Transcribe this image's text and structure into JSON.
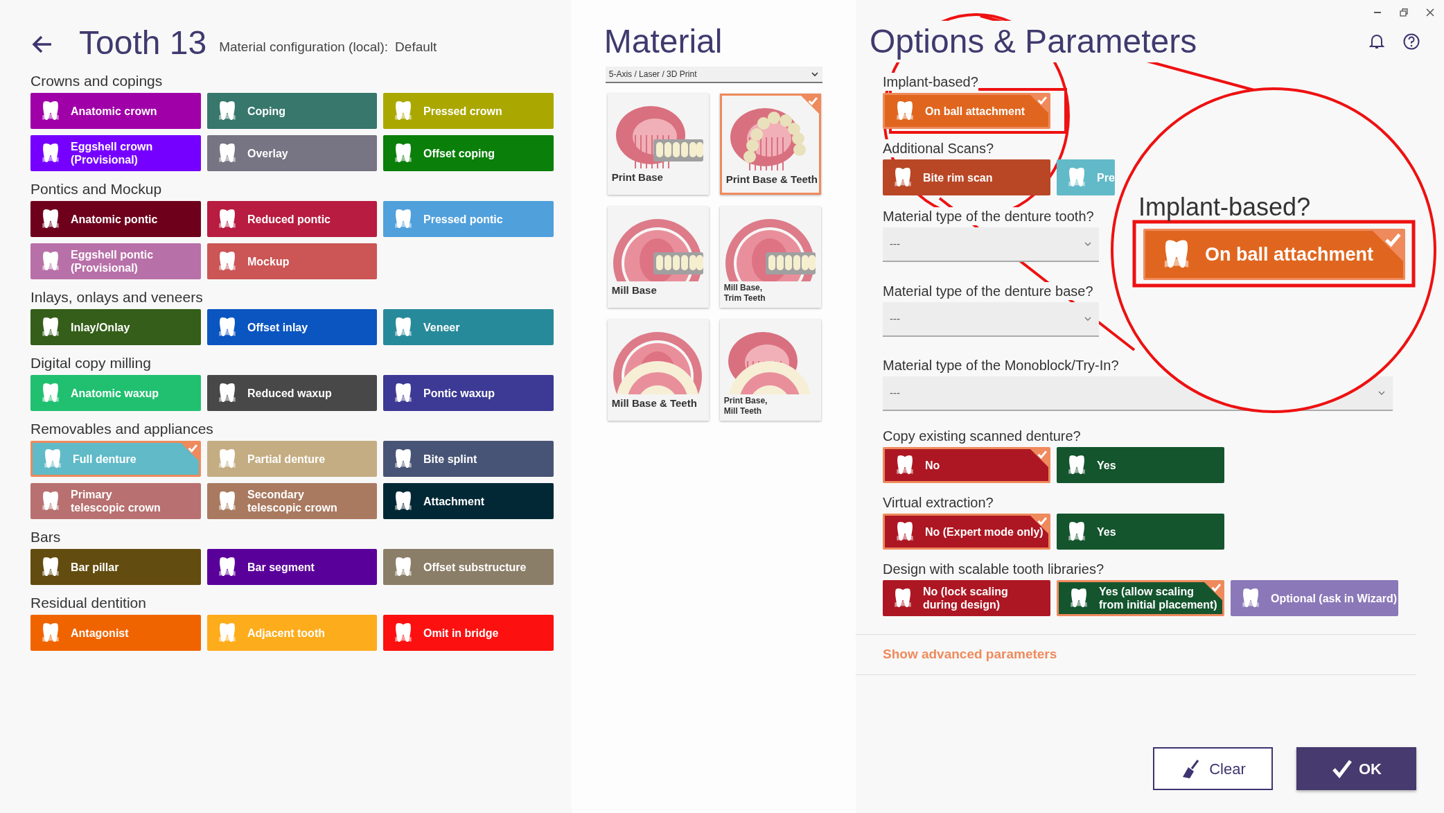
{
  "header": {
    "title": "Tooth 13",
    "config_label": "Material configuration (local):",
    "config_value": "Default"
  },
  "sections": [
    {
      "title": "Crowns and copings",
      "items": [
        {
          "label": "Anatomic crown",
          "color": "#a000a8",
          "selected": false
        },
        {
          "label": "Coping",
          "color": "#37776c",
          "selected": false
        },
        {
          "label": "Pressed crown",
          "color": "#aaa800",
          "selected": false
        },
        {
          "label": "Eggshell crown\n(Provisional)",
          "color": "#7600ff",
          "selected": false
        },
        {
          "label": "Overlay",
          "color": "#777584",
          "selected": false
        },
        {
          "label": "Offset coping",
          "color": "#0a7f0a",
          "selected": false
        }
      ]
    },
    {
      "title": "Pontics and Mockup",
      "items": [
        {
          "label": "Anatomic pontic",
          "color": "#6e001c",
          "selected": false
        },
        {
          "label": "Reduced pontic",
          "color": "#b81c40",
          "selected": false
        },
        {
          "label": "Pressed pontic",
          "color": "#50a0dc",
          "selected": false
        },
        {
          "label": "Eggshell pontic\n(Provisional)",
          "color": "#b870a8",
          "selected": false
        },
        {
          "label": "Mockup",
          "color": "#cc5555",
          "selected": false
        }
      ]
    },
    {
      "title": "Inlays, onlays and veneers",
      "items": [
        {
          "label": "Inlay/Onlay",
          "color": "#345e19",
          "selected": false
        },
        {
          "label": "Offset inlay",
          "color": "#0b55c0",
          "selected": false
        },
        {
          "label": "Veneer",
          "color": "#278a9a",
          "selected": false
        }
      ]
    },
    {
      "title": "Digital copy milling",
      "items": [
        {
          "label": "Anatomic waxup",
          "color": "#20c070",
          "selected": false
        },
        {
          "label": "Reduced waxup",
          "color": "#484848",
          "selected": false
        },
        {
          "label": "Pontic waxup",
          "color": "#3c3a94",
          "selected": false
        }
      ]
    },
    {
      "title": "Removables and appliances",
      "items": [
        {
          "label": "Full denture",
          "color": "#60bac8",
          "selected": true
        },
        {
          "label": "Partial denture",
          "color": "#c4ad82",
          "selected": false
        },
        {
          "label": "Bite splint",
          "color": "#485476",
          "selected": false
        },
        {
          "label": "Primary\ntelescopic crown",
          "color": "#b87070",
          "selected": false
        },
        {
          "label": "Secondary\ntelescopic crown",
          "color": "#a97a60",
          "selected": false
        },
        {
          "label": "Attachment",
          "color": "#022836",
          "selected": false
        }
      ]
    },
    {
      "title": "Bars",
      "items": [
        {
          "label": "Bar pillar",
          "color": "#634c0f",
          "selected": false
        },
        {
          "label": "Bar segment",
          "color": "#5a009a",
          "selected": false
        },
        {
          "label": "Offset substructure",
          "color": "#8b7e68",
          "selected": false
        }
      ]
    },
    {
      "title": "Residual dentition",
      "items": [
        {
          "label": "Antagonist",
          "color": "#f06400",
          "selected": false
        },
        {
          "label": "Adjacent tooth",
          "color": "#fdac1c",
          "selected": false
        },
        {
          "label": "Omit in bridge",
          "color": "#fc1010",
          "selected": false
        }
      ]
    }
  ],
  "material": {
    "title": "Material",
    "dropdown": "5-Axis / Laser / 3D Print",
    "cards": [
      {
        "label": "Print Base",
        "selected": false
      },
      {
        "label": "Print Base & Teeth",
        "selected": true
      },
      {
        "label": "Mill Base",
        "selected": false
      },
      {
        "label": "Mill Base,\nTrim Teeth",
        "selected": false
      },
      {
        "label": "Mill Base & Teeth",
        "selected": false
      },
      {
        "label": "Print Base,\nMill Teeth",
        "selected": false
      }
    ]
  },
  "options": {
    "title": "Options & Parameters",
    "questions": [
      {
        "kind": "buttons",
        "label": "Implant-based?",
        "options": [
          {
            "label": "On ball attachment",
            "color": "#e0661f",
            "selected": true
          }
        ]
      },
      {
        "kind": "buttons",
        "label": "Additional Scans?",
        "options": [
          {
            "label": "Bite rim scan",
            "color": "#b94726",
            "selected": false
          },
          {
            "label": "Pre",
            "color": "#62bac8",
            "selected": false
          }
        ]
      },
      {
        "kind": "dropdown",
        "label": "Material type of the denture tooth?",
        "value": "---"
      },
      {
        "kind": "dropdown",
        "label": "Material type of the denture base?",
        "value": "---"
      },
      {
        "kind": "dropdown",
        "label": "Material type of the Monoblock/Try-In?",
        "value": "---"
      },
      {
        "kind": "buttons",
        "label": "Copy existing scanned denture?",
        "options": [
          {
            "label": "No",
            "color": "#ad1723",
            "selected": true
          },
          {
            "label": "Yes",
            "color": "#14552e",
            "selected": false
          }
        ]
      },
      {
        "kind": "buttons",
        "label": "Virtual extraction?",
        "options": [
          {
            "label": "No (Expert mode only)",
            "color": "#ad1723",
            "selected": true
          },
          {
            "label": "Yes",
            "color": "#14552e",
            "selected": false
          }
        ]
      },
      {
        "kind": "buttons",
        "label": "Design with scalable tooth libraries?",
        "options": [
          {
            "label": "No (lock scaling\nduring design)",
            "color": "#ad1723",
            "selected": false
          },
          {
            "label": "Yes (allow scaling\nfrom initial placement)",
            "color": "#14552e",
            "selected": true
          },
          {
            "label": "Optional (ask in Wizard)",
            "color": "#8b78b8",
            "selected": false
          }
        ]
      }
    ],
    "advanced_link": "Show advanced parameters"
  },
  "magnifier": {
    "label": "Implant-based?",
    "button": {
      "label": "On ball attachment",
      "selected": true
    }
  },
  "footer": {
    "clear": "Clear",
    "ok": "OK"
  }
}
